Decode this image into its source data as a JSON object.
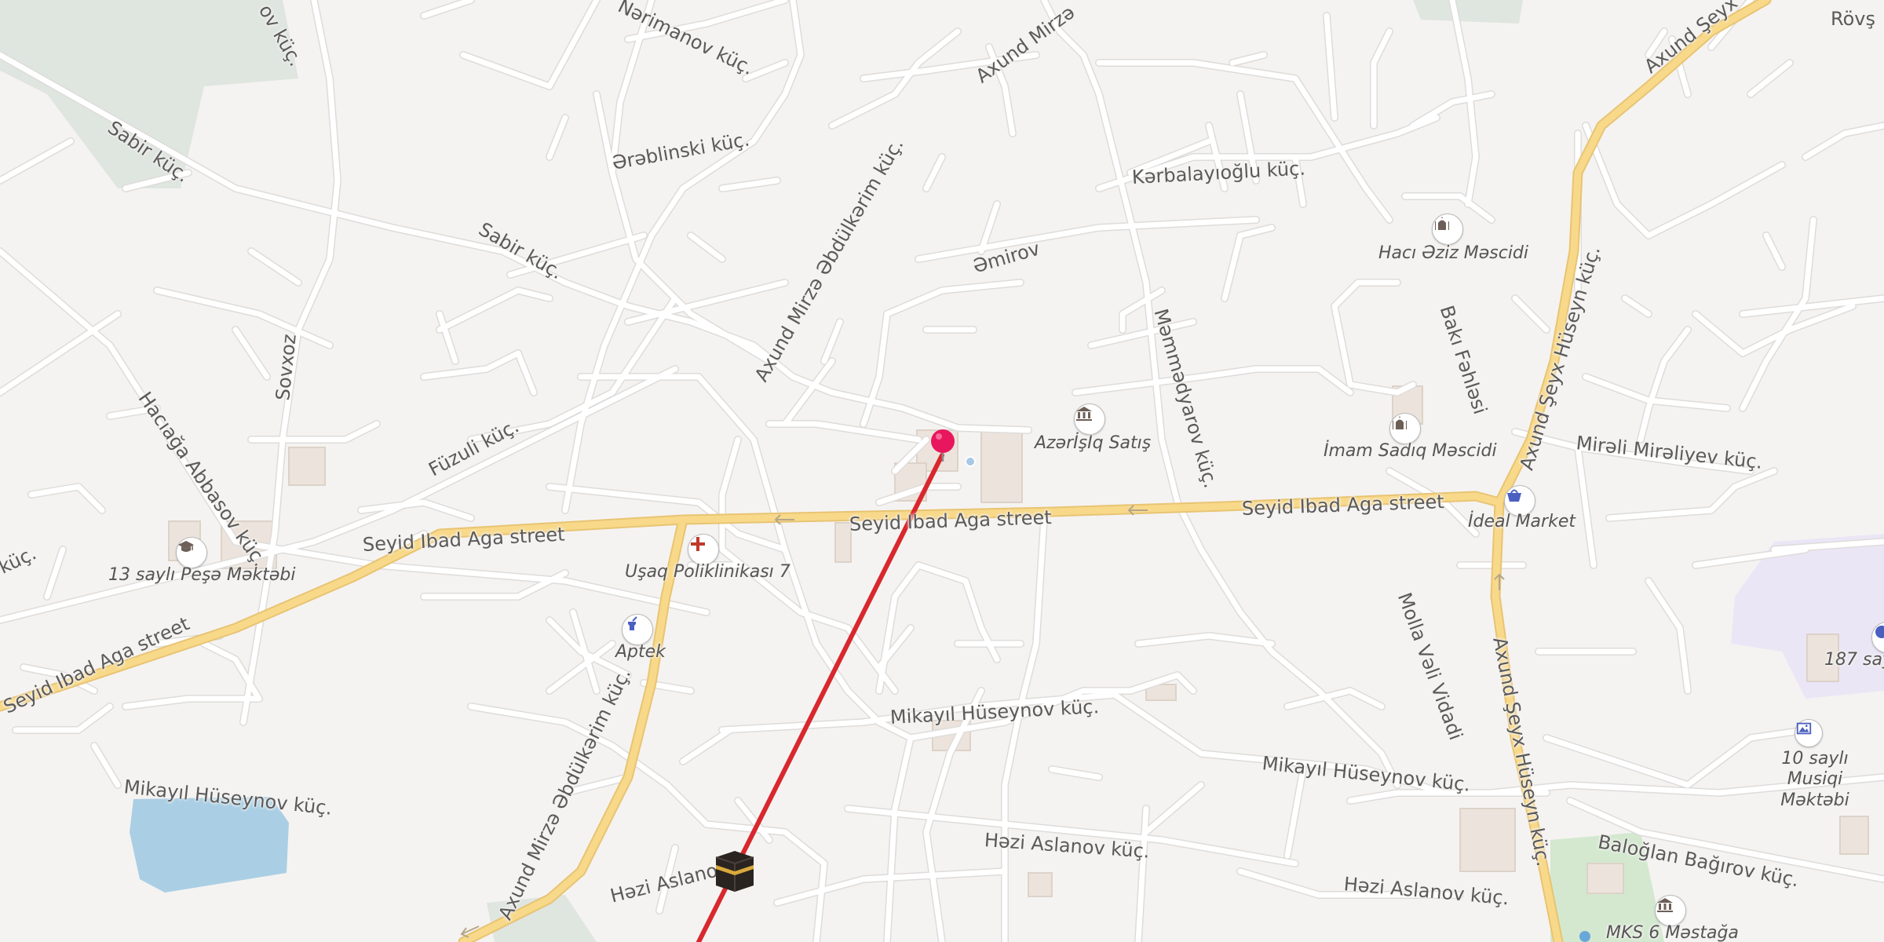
{
  "streets": {
    "narimanov": "Nərimanov küç.",
    "axund_top": "Axund Mirzə",
    "arablinski": "Ərəblinski küç.",
    "sabir1": "Sabir küç.",
    "sabir2": "Sabir küç.",
    "karbalayioglu": "Kərbalayıoğlu küç.",
    "amirov": "Əmirov",
    "axund_abdulkarim": "Axund Mirzə Əbdülkərim küç.",
    "sovxoz": "Sovxoz",
    "haciaga": "Hacıağa Abbasov küç.",
    "fuzuli": "Füzuli küç.",
    "mammadyarov": "Məmmədyarov küç.",
    "baki_fahlasi": "Bakı Fəhləsi",
    "axund_seyx_top": "Axund Şeyx Hüseyn küç.",
    "axund_seyx_mid": "Axund Şeyx Hüseyn küç.",
    "axund_seyx_bottom": "Axund Şeyx Hüseyn küç.",
    "rovs": "Rövş",
    "mirali": "Mirəli Mirəliyev küç.",
    "seyid_left": "Seyid Ibad Aga street",
    "seyid_center": "Seyid Ibad Aga street",
    "seyid_right": "Seyid Ibad Aga street",
    "seyid_sw": "Seyid Ibad Aga street",
    "kuc_left": "küç.",
    "molla": "Molla Vəli Vidadi",
    "mikayil1": "Mikayıl Hüseynov küç.",
    "mikayil2": "Mikayıl Hüseynov küç.",
    "mikayil3": "Mikayıl Hüseynov küç.",
    "axund_sw": "Axund Mirzə Əbdülkərim küç.",
    "hazi1": "Həzi Aslanov küç.",
    "hazi2": "Həzi Aslanov küç.",
    "hazi3": "Həzi Aslano",
    "baloglan": "Baloğlan Bağırov küç.",
    "top_kuc": "ov küç."
  },
  "pois": {
    "haci_aziz": {
      "label": "Hacı Əziz Məscidi",
      "icon": "mosque-icon"
    },
    "imam_sadiq": {
      "label": "İmam Sadıq Məscidi",
      "icon": "mosque-icon"
    },
    "azerisiq": {
      "label": "AzərİşIq Satış",
      "icon": "government-building-icon"
    },
    "ideal_market": {
      "label": "İdeal Market",
      "icon": "shopping-basket-icon"
    },
    "usaq_poliklinika": {
      "label": "Uşaq Poliklinikası 7",
      "icon": "medical-cross-icon"
    },
    "aptek": {
      "label": "Aptek",
      "icon": "pharmacy-icon"
    },
    "mekteb13": {
      "label": "13 saylı Peşə Məktəbi",
      "icon": "graduation-cap-icon"
    },
    "musiqi": {
      "label": "10 saylı Musiqi Məktəbi",
      "icon": "art-gallery-icon"
    },
    "school187": {
      "label": "187 say",
      "icon": "school-icon"
    },
    "mks": {
      "label": "MKS 6 Məstağa",
      "icon": "government-building-icon"
    }
  },
  "markers": {
    "pin": {
      "icon": "location-pin-icon",
      "color": "#e8175d"
    },
    "qibla": {
      "icon": "kaaba-icon"
    }
  },
  "colors": {
    "background": "#f5f3f1",
    "road": "#ffffff",
    "road_casing": "#dedcda",
    "main_road": "#f8d98a",
    "main_road_casing": "#e8c473",
    "water": "#aacfe5",
    "park": "#dfe5df",
    "green": "#d3e8cf",
    "school_area": "#ebe6f6",
    "building": "#ece4dc",
    "qibla_line": "#d8282e"
  }
}
